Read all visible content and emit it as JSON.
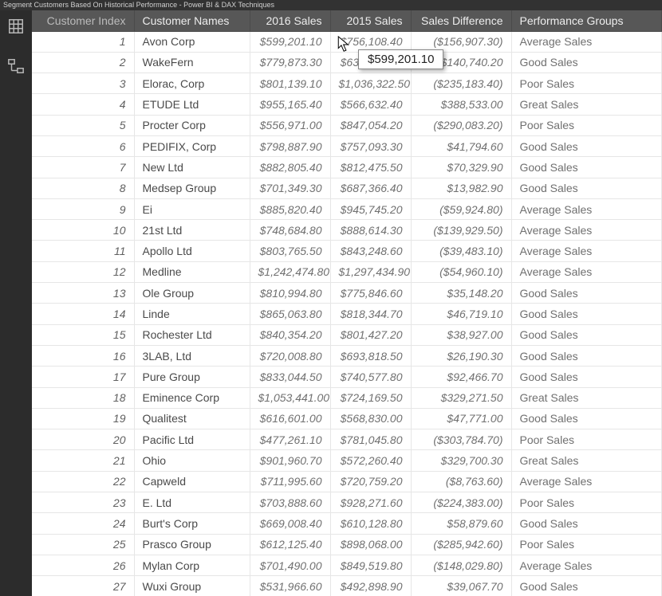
{
  "window": {
    "title": "Segment Customers Based On Historical Performance - Power BI & DAX Techniques"
  },
  "columns": {
    "idx": "Customer Index",
    "name": "Customer Names",
    "s2016": "2016 Sales",
    "s2015": "2015 Sales",
    "diff": "Sales Difference",
    "grp": "Performance Groups"
  },
  "tooltip": {
    "value": "$599,201.10"
  },
  "rows": [
    {
      "idx": "1",
      "name": "Avon Corp",
      "s2016": "$599,201.10",
      "s2015": "$756,108.40",
      "diff": "($156,907.30)",
      "grp": "Average Sales"
    },
    {
      "idx": "2",
      "name": "WakeFern",
      "s2016": "$779,873.30",
      "s2015": "$639,133.10",
      "diff": "$140,740.20",
      "grp": "Good Sales"
    },
    {
      "idx": "3",
      "name": "Elorac, Corp",
      "s2016": "$801,139.10",
      "s2015": "$1,036,322.50",
      "diff": "($235,183.40)",
      "grp": "Poor Sales"
    },
    {
      "idx": "4",
      "name": "ETUDE Ltd",
      "s2016": "$955,165.40",
      "s2015": "$566,632.40",
      "diff": "$388,533.00",
      "grp": "Great Sales"
    },
    {
      "idx": "5",
      "name": "Procter Corp",
      "s2016": "$556,971.00",
      "s2015": "$847,054.20",
      "diff": "($290,083.20)",
      "grp": "Poor Sales"
    },
    {
      "idx": "6",
      "name": "PEDIFIX, Corp",
      "s2016": "$798,887.90",
      "s2015": "$757,093.30",
      "diff": "$41,794.60",
      "grp": "Good Sales"
    },
    {
      "idx": "7",
      "name": "New Ltd",
      "s2016": "$882,805.40",
      "s2015": "$812,475.50",
      "diff": "$70,329.90",
      "grp": "Good Sales"
    },
    {
      "idx": "8",
      "name": "Medsep Group",
      "s2016": "$701,349.30",
      "s2015": "$687,366.40",
      "diff": "$13,982.90",
      "grp": "Good Sales"
    },
    {
      "idx": "9",
      "name": "Ei",
      "s2016": "$885,820.40",
      "s2015": "$945,745.20",
      "diff": "($59,924.80)",
      "grp": "Average Sales"
    },
    {
      "idx": "10",
      "name": "21st Ltd",
      "s2016": "$748,684.80",
      "s2015": "$888,614.30",
      "diff": "($139,929.50)",
      "grp": "Average Sales"
    },
    {
      "idx": "11",
      "name": "Apollo Ltd",
      "s2016": "$803,765.50",
      "s2015": "$843,248.60",
      "diff": "($39,483.10)",
      "grp": "Average Sales"
    },
    {
      "idx": "12",
      "name": "Medline",
      "s2016": "$1,242,474.80",
      "s2015": "$1,297,434.90",
      "diff": "($54,960.10)",
      "grp": "Average Sales"
    },
    {
      "idx": "13",
      "name": "Ole Group",
      "s2016": "$810,994.80",
      "s2015": "$775,846.60",
      "diff": "$35,148.20",
      "grp": "Good Sales"
    },
    {
      "idx": "14",
      "name": "Linde",
      "s2016": "$865,063.80",
      "s2015": "$818,344.70",
      "diff": "$46,719.10",
      "grp": "Good Sales"
    },
    {
      "idx": "15",
      "name": "Rochester Ltd",
      "s2016": "$840,354.20",
      "s2015": "$801,427.20",
      "diff": "$38,927.00",
      "grp": "Good Sales"
    },
    {
      "idx": "16",
      "name": "3LAB, Ltd",
      "s2016": "$720,008.80",
      "s2015": "$693,818.50",
      "diff": "$26,190.30",
      "grp": "Good Sales"
    },
    {
      "idx": "17",
      "name": "Pure Group",
      "s2016": "$833,044.50",
      "s2015": "$740,577.80",
      "diff": "$92,466.70",
      "grp": "Good Sales"
    },
    {
      "idx": "18",
      "name": "Eminence Corp",
      "s2016": "$1,053,441.00",
      "s2015": "$724,169.50",
      "diff": "$329,271.50",
      "grp": "Great Sales"
    },
    {
      "idx": "19",
      "name": "Qualitest",
      "s2016": "$616,601.00",
      "s2015": "$568,830.00",
      "diff": "$47,771.00",
      "grp": "Good Sales"
    },
    {
      "idx": "20",
      "name": "Pacific Ltd",
      "s2016": "$477,261.10",
      "s2015": "$781,045.80",
      "diff": "($303,784.70)",
      "grp": "Poor Sales"
    },
    {
      "idx": "21",
      "name": "Ohio",
      "s2016": "$901,960.70",
      "s2015": "$572,260.40",
      "diff": "$329,700.30",
      "grp": "Great Sales"
    },
    {
      "idx": "22",
      "name": "Capweld",
      "s2016": "$711,995.60",
      "s2015": "$720,759.20",
      "diff": "($8,763.60)",
      "grp": "Average Sales"
    },
    {
      "idx": "23",
      "name": "E. Ltd",
      "s2016": "$703,888.60",
      "s2015": "$928,271.60",
      "diff": "($224,383.00)",
      "grp": "Poor Sales"
    },
    {
      "idx": "24",
      "name": "Burt's Corp",
      "s2016": "$669,008.40",
      "s2015": "$610,128.80",
      "diff": "$58,879.60",
      "grp": "Good Sales"
    },
    {
      "idx": "25",
      "name": "Prasco Group",
      "s2016": "$612,125.40",
      "s2015": "$898,068.00",
      "diff": "($285,942.60)",
      "grp": "Poor Sales"
    },
    {
      "idx": "26",
      "name": "Mylan Corp",
      "s2016": "$701,490.00",
      "s2015": "$849,519.80",
      "diff": "($148,029.80)",
      "grp": "Average Sales"
    },
    {
      "idx": "27",
      "name": "Wuxi Group",
      "s2016": "$531,966.60",
      "s2015": "$492,898.90",
      "diff": "$39,067.70",
      "grp": "Good Sales"
    }
  ]
}
